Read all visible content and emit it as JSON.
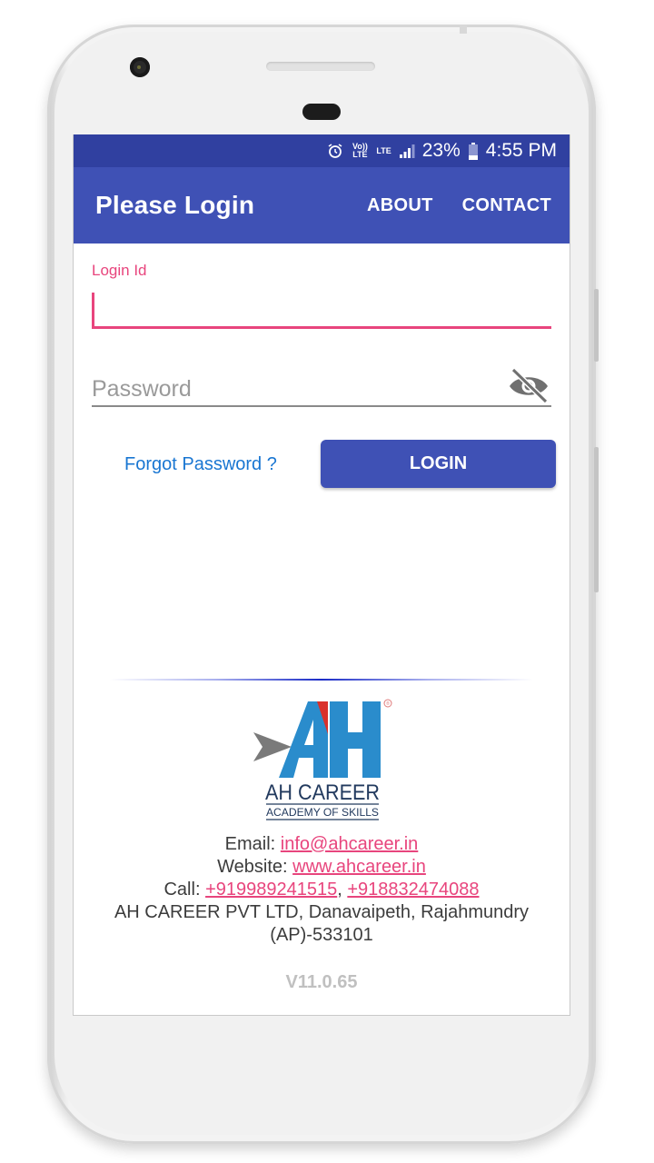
{
  "status_bar": {
    "icons": [
      "alarm-icon",
      "volte-icon",
      "lte-icon",
      "signal-icon"
    ],
    "volte_label": "Vo)) LTE",
    "lte_label": "LTE",
    "battery_percent": "23%",
    "time": "4:55 PM"
  },
  "app_bar": {
    "title": "Please Login",
    "menu": [
      {
        "label": "ABOUT"
      },
      {
        "label": "CONTACT"
      }
    ]
  },
  "form": {
    "login_id": {
      "label": "Login Id",
      "value": ""
    },
    "password": {
      "placeholder": "Password",
      "value": "",
      "toggle_icon": "visibility-off-icon"
    },
    "forgot_label": "Forgot Password ?",
    "login_label": "LOGIN"
  },
  "logo": {
    "letters": "AH",
    "name": "AH CAREER",
    "tagline": "ACADEMY OF SKILLS",
    "registered": "®"
  },
  "footer": {
    "email_label": "Email: ",
    "email": "info@ahcareer.in",
    "website_label": "Website: ",
    "website": "www.ahcareer.in",
    "call_label": "Call: ",
    "phones": [
      "+919989241515",
      "+918832474088"
    ],
    "phone_separator": ", ",
    "address_line1": "AH CAREER PVT LTD, Danavaipeth, Rajahmundry",
    "address_line2": "(AP)-533101",
    "version": "V11.0.65"
  },
  "colors": {
    "primary": "#3f51b5",
    "primary_dark": "#3040a0",
    "accent": "#e8457d",
    "link_blue": "#1976d2"
  }
}
